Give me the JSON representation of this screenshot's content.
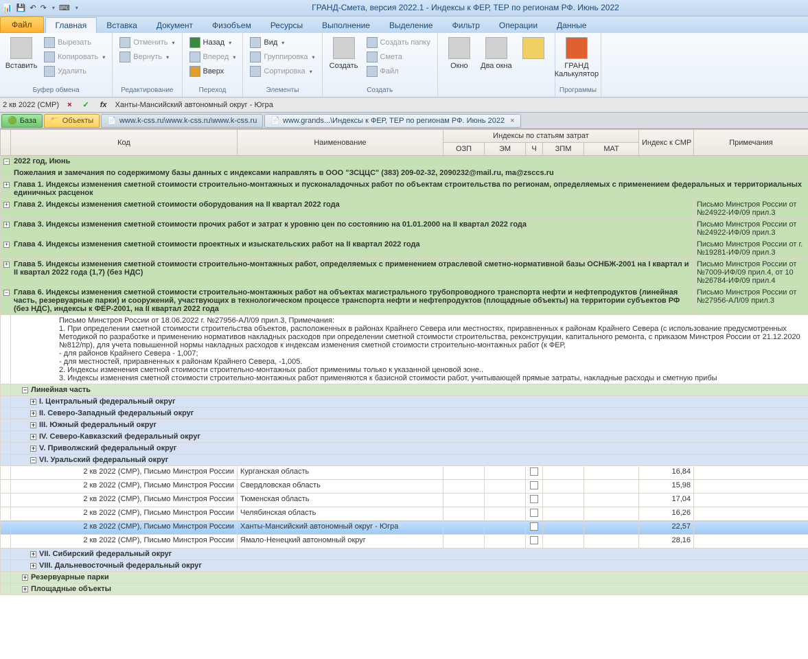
{
  "title": "ГРАНД-Смета, версия 2022.1 - Индексы к ФЕР, ТЕР по регионам РФ. Июнь 2022",
  "file_tab": "Файл",
  "tabs": [
    "Главная",
    "Вставка",
    "Документ",
    "Физобъем",
    "Ресурсы",
    "Выполнение",
    "Выделение",
    "Фильтр",
    "Операции",
    "Данные"
  ],
  "ribbon": {
    "clipboard": {
      "title": "Буфер обмена",
      "paste": "Вставить",
      "cut": "Вырезать",
      "copy": "Копировать",
      "delete": "Удалить"
    },
    "editing": {
      "title": "Редактирование",
      "undo": "Отменить",
      "redo": "Вернуть"
    },
    "goto": {
      "title": "Переход",
      "back": "Назад",
      "forward": "Вперед",
      "up": "Вверх"
    },
    "elements": {
      "title": "Элементы",
      "view": "Вид",
      "group": "Группировка",
      "sort": "Сортировка"
    },
    "create_group": {
      "title": "Создать",
      "create": "Создать",
      "folder": "Создать папку",
      "estimate": "Смета",
      "file": "Файл"
    },
    "window_group": {
      "title": "",
      "window": "Окно",
      "two": "Два окна"
    },
    "programs": {
      "title": "Программы",
      "calc": "ГРАНД Калькулятор"
    }
  },
  "formula": {
    "cell": "2 кв 2022 (СМР)",
    "x": "×",
    "check": "✓",
    "fx": "fx",
    "text": "Ханты-Мансийский автономный округ - Югра"
  },
  "doc_tabs": {
    "db": "База",
    "obj": "Объекты",
    "p1": "www.k-css.ru\\www.k-css.ru\\www.k-css.ru",
    "p2": "www.grands...\\Индексы к ФЕР, ТЕР по регионам РФ. Июнь 2022"
  },
  "headers": {
    "code": "Код",
    "name": "Наименование",
    "idx_group": "Индексы по статьям затрат",
    "ozp": "ОЗП",
    "em": "ЭМ",
    "ch": "Ч",
    "zpm": "ЗПМ",
    "mat": "МАТ",
    "smr": "Индекс к СМР",
    "note": "Примечания"
  },
  "rows": {
    "year": "2022 год, Июнь",
    "wish": "Пожелания и замечания по содержимому базы данных с индексами направлять в ООО \"ЗСЦЦС\" (383) 209-02-32, 2090232@mail.ru, ma@zsccs.ru",
    "ch1": "Глава 1. Индексы изменения сметной стоимости строительно-монтажных и пусконаладочных работ по объектам строительства по регионам, определяемых с применением федеральных и территориальных единичных расценок",
    "ch2": "Глава 2. Индексы изменения сметной стоимости оборудования на II квартал 2022 года",
    "ch2_note": "Письмо Минстроя России от №24922-ИФ/09 прил.3",
    "ch3": "Глава 3. Индексы изменения сметной стоимости прочих работ и затрат к уровню цен по состоянию на 01.01.2000 на II квартал 2022 года",
    "ch3_note": "Письмо Минстроя России от №24922-ИФ/09 прил.3",
    "ch4": "Глава 4. Индексы изменения сметной стоимости проектных и изыскательских работ на II квартал 2022 года",
    "ch4_note": "Письмо Минстроя России  от г. №19281-ИФ/09 прил.3",
    "ch5": "Глава 5. Индексы изменения сметной стоимости строительно-монтажных работ, определяемых с применением отраслевой сметно-нормативной базы ОСНБЖ-2001 на I квартал и II квартал 2022 года (1,7) (без НДС)",
    "ch5_note": "Письмо Минстроя России от №7009-ИФ/09 прил.4, от 10 №26784-ИФ/09 прил.4",
    "ch6": "Глава 6. Индексы изменения сметной стоимости строительно-монтажных работ на объектах магистрального трубопроводного транспорта нефти и нефтепродуктов (линейная часть, резервуарные парки) и сооружений, участвующих в технологическом процессе транспорта нефти и нефтепродуктов (площадные объекты) на территории субъектов РФ (без НДС), индексы к ФЕР-2001, на II квартал 2022 года",
    "ch6_note": "Письмо Минстроя России от №27956-АЛ/09 прил.3",
    "ch6_detail": "Письмо Минстроя России от 18.06.2022 г. №27956-АЛ/09 прил.3, Примечания:\n1. При определении сметной стоимости строительства объектов, расположенных в районах Крайнего Севера или местностях, приравненных к районам Крайнего Севера (с использование предусмотренных Методикой по разработке и применению нормативов накладных расходов при определении сметной стоимости строительства, реконструкции, капитального ремонта, с приказом Минстроя России от 21.12.2020 №812/пр), для учета повышенной нормы накладных расходов к индексам изменения сметной стоимости строительно-монтажных работ (к ФЕР,\n- для районов Крайнего Севера - 1,007;\n- для местностей, приравненных к районам Крайнего Севера, -1,005.\n2. Индексы изменения сметной стоимости строительно-монтажных  работ применимы только к указанной ценовой зоне..\n3. Индексы изменения сметной стоимости строительно-монтажных  работ применяются к базисной стоимости работ, учитывающей прямые затраты, накладные расходы и сметную прибы",
    "linear": "Линейная часть",
    "d1": "I. Центральный федеральный округ",
    "d2": "II. Северо-Западный федеральный округ",
    "d3": "III. Южный федеральный округ",
    "d4": "IV. Северо-Кавказский федеральный округ",
    "d5": "V. Приволжский федеральный округ",
    "d6": "VI. Уральский федеральный округ",
    "d7": "VII. Сибирский федеральный округ",
    "d8": "VIII. Дальневосточный федеральный округ",
    "reserv": "Резервуарные парки",
    "area": "Площадные объекты",
    "code_common": "2 кв 2022 (СМР), Письмо Минстроя России",
    "regions": {
      "r1": {
        "name": "Курганская область",
        "smr": "16,84"
      },
      "r2": {
        "name": "Свердловская область",
        "smr": "15,98"
      },
      "r3": {
        "name": "Тюменская область",
        "smr": "17,04"
      },
      "r4": {
        "name": "Челябинская область",
        "smr": "16,26"
      },
      "r5": {
        "name": "Ханты-Мансийский автономный округ - Югра",
        "smr": "22,57"
      },
      "r6": {
        "name": "Ямало-Ненецкий  автономный округ",
        "smr": "28,16"
      }
    }
  }
}
